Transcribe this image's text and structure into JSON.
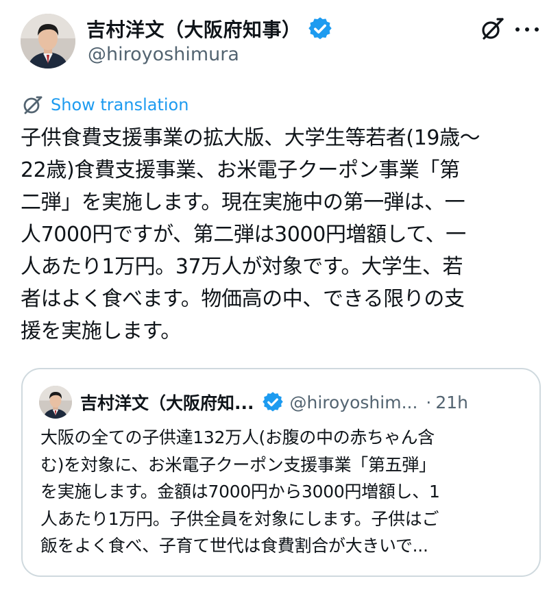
{
  "author": {
    "display_name": "吉村洋文（大阪府知事）",
    "handle": "@hiroyoshimura",
    "verified": true,
    "avatar": "profile-photo"
  },
  "icons": {
    "verified": "verified-badge-icon",
    "grok": "grok-icon",
    "more": "more-options-icon",
    "translate": "translate-icon"
  },
  "colors": {
    "verified_blue": "#1d9bf0",
    "link_blue": "#1d9bf0",
    "secondary_text": "#536471",
    "border": "#cfd9de"
  },
  "translate": {
    "label": "Show translation"
  },
  "tweet": {
    "lines": [
      "子供食費支援事業の拡大版、大学生等若者(19歳〜",
      "22歳)食費支援事業、お米電子クーポン事業「第",
      "二弾」を実施します。現在実施中の第一弾は、一",
      "人7000円ですが、第二弾は3000円増額して、一",
      "人あたり1万円。37万人が対象です。大学生、若",
      "者はよく食べます。物価高の中、できる限りの支",
      "援を実施します。"
    ]
  },
  "quoted_tweet": {
    "display_name": "吉村洋文（大阪府知...",
    "handle": "@hiroyoshim...",
    "separator": "·",
    "time": "21h",
    "lines": [
      "大阪の全ての子供達132万人(お腹の中の赤ちゃん含",
      "む)を対象に、お米電子クーポン支援事業「第五弾」",
      "を実施します。金額は7000円から3000円増額し、1",
      "人あたり1万円。子供全員を対象にします。子供はご",
      "飯をよく食べ、子育て世代は食費割合が大きいで..."
    ]
  }
}
